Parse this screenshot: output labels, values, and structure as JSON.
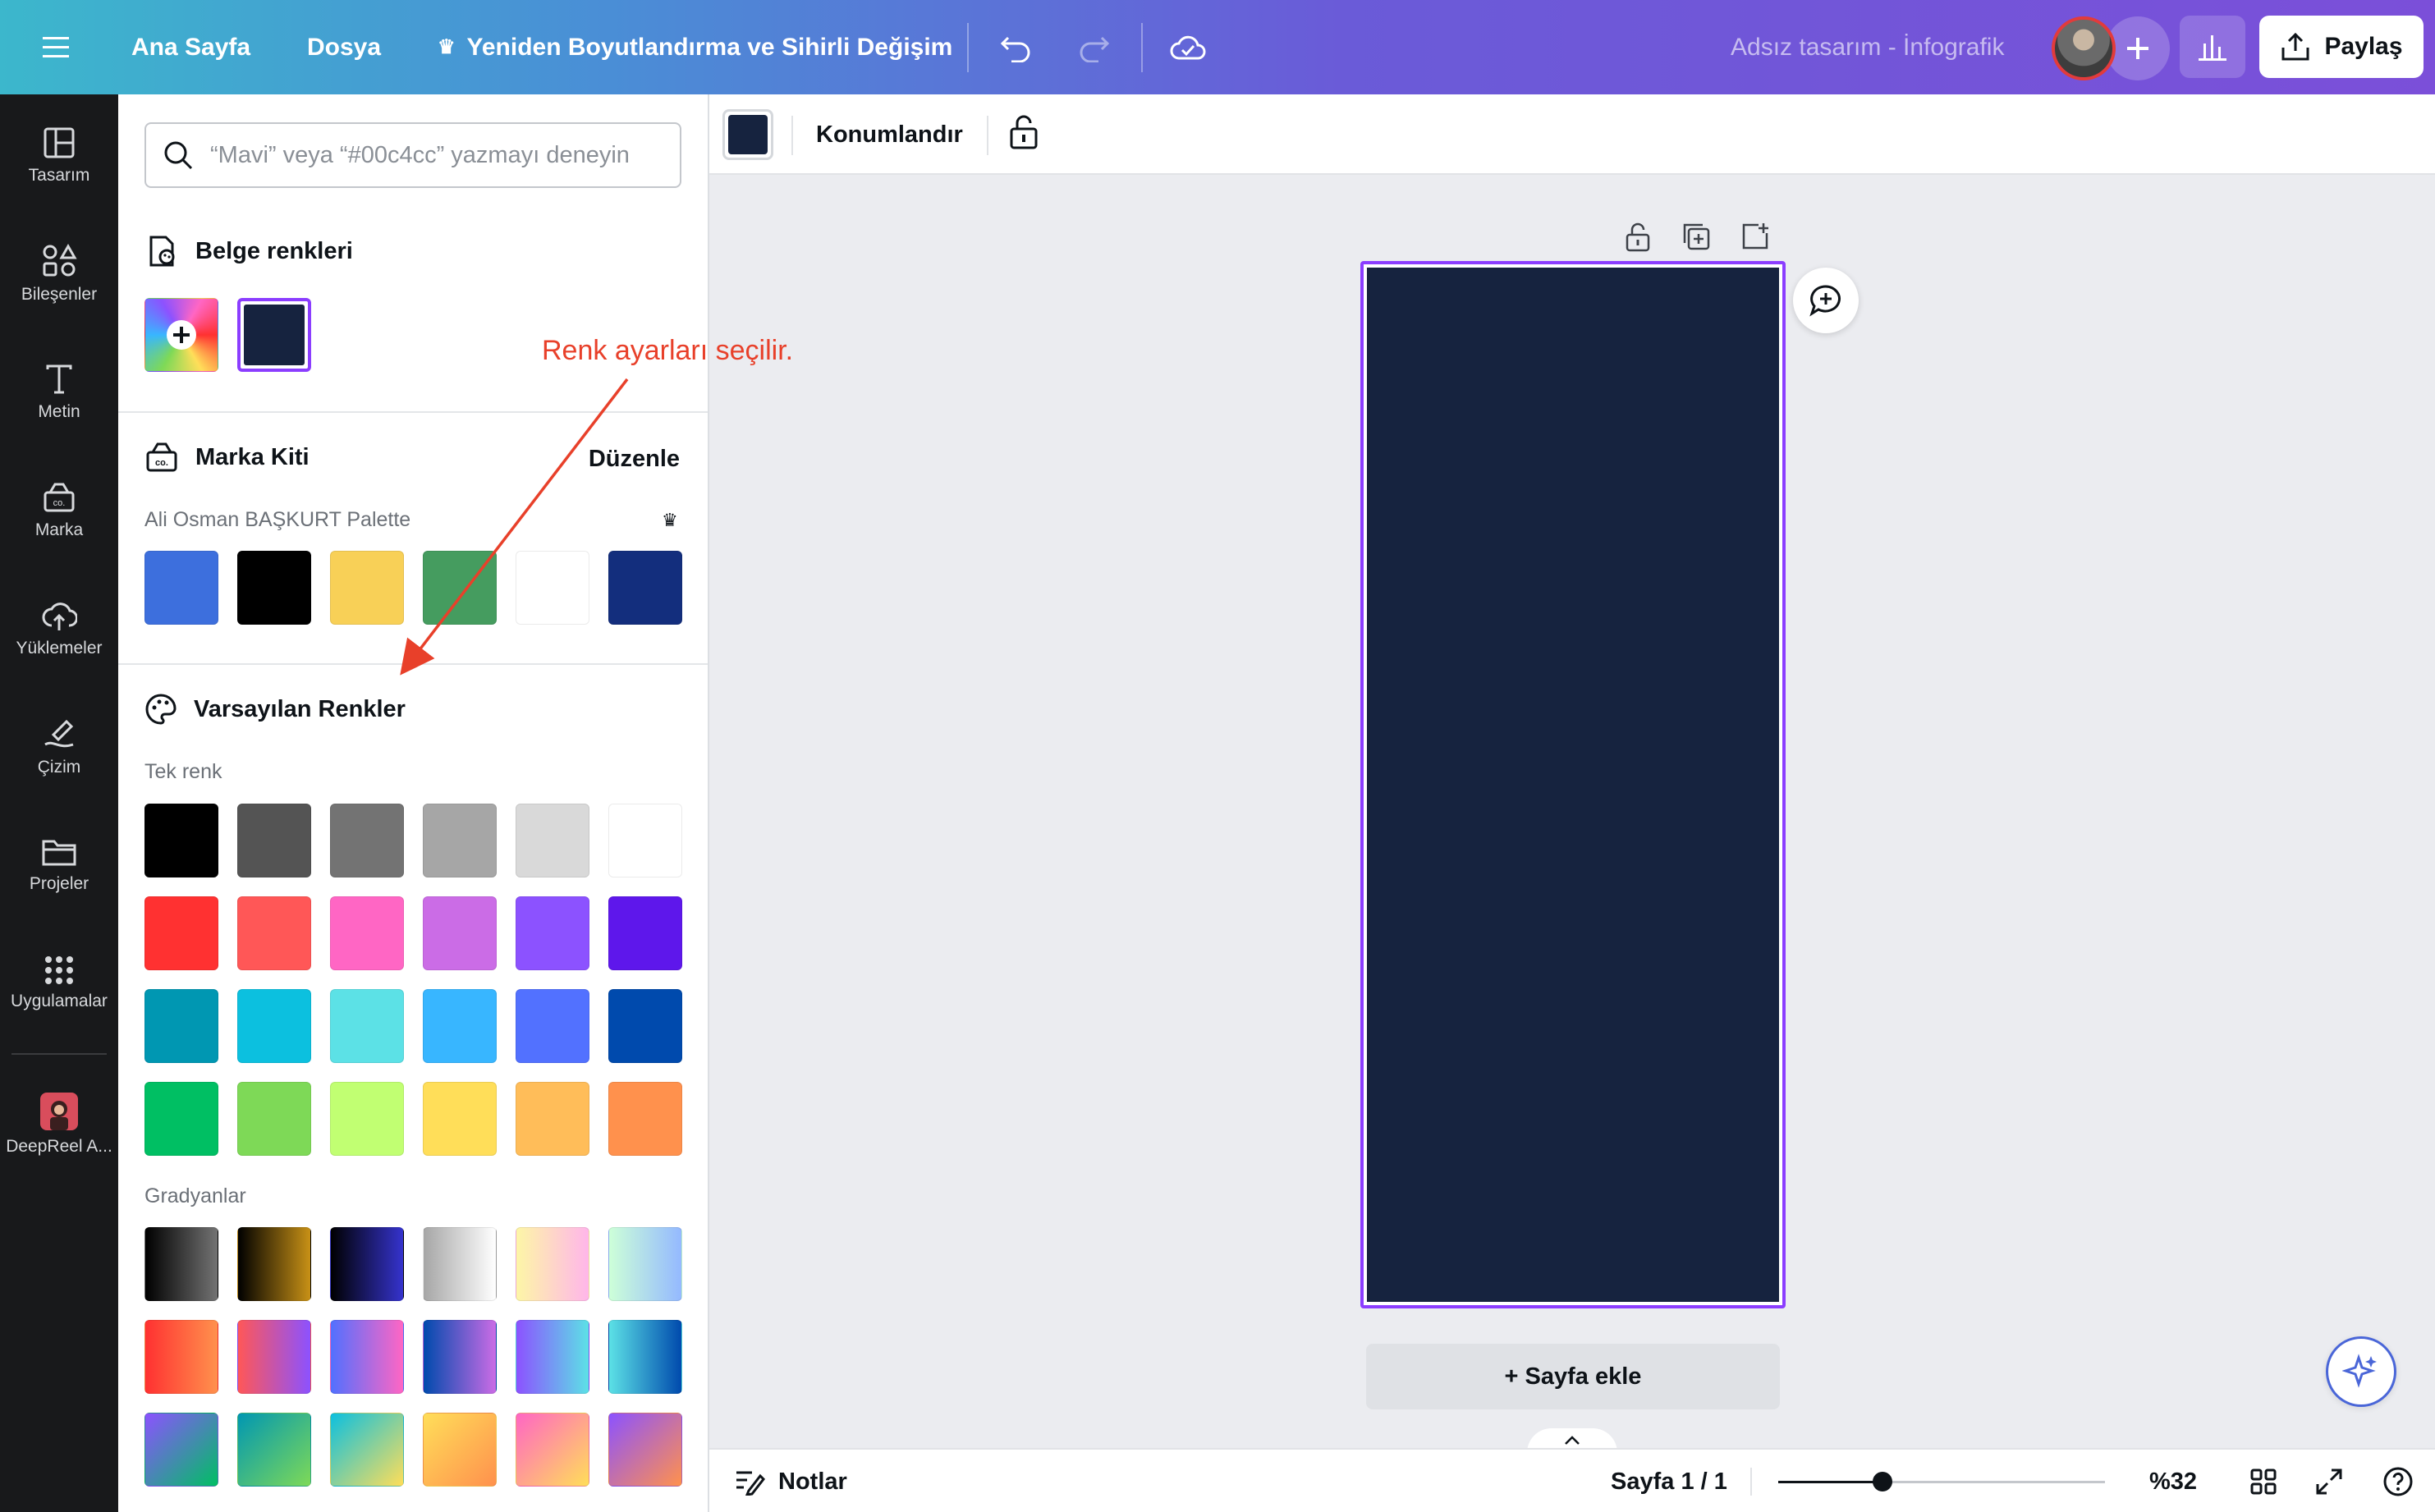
{
  "topbar": {
    "menu_icon": "hamburger-icon",
    "home": "Ana Sayfa",
    "file": "Dosya",
    "resize": "Yeniden Boyutlandırma ve Sihirli Değişim",
    "design_title": "Adsız tasarım - İnfografik",
    "share": "Paylaş"
  },
  "rail": {
    "items": [
      {
        "label": "Tasarım",
        "icon": "layout-icon"
      },
      {
        "label": "Bileşenler",
        "icon": "elements-icon"
      },
      {
        "label": "Metin",
        "icon": "text-icon"
      },
      {
        "label": "Marka",
        "icon": "brand-icon"
      },
      {
        "label": "Yüklemeler",
        "icon": "upload-icon"
      },
      {
        "label": "Çizim",
        "icon": "draw-icon"
      },
      {
        "label": "Projeler",
        "icon": "folder-icon"
      },
      {
        "label": "Uygulamalar",
        "icon": "apps-icon"
      },
      {
        "label": "DeepReel A...",
        "icon": "deepreel-app-icon"
      }
    ]
  },
  "panel": {
    "search_placeholder": "“Mavi” veya “#00c4cc” yazmayı deneyin",
    "doc_colors_title": "Belge renkleri",
    "doc_colors": [
      "#16233f"
    ],
    "brand_kit_title": "Marka Kiti",
    "brand_kit_edit": "Düzenle",
    "palette_name": "Ali Osman BAŞKURT Palette",
    "brand_colors": [
      "#3d6fdd",
      "#000000",
      "#f8d057",
      "#459c5f",
      "#ffffff",
      "#132e7d"
    ],
    "default_title": "Varsayılan Renkler",
    "solid_label": "Tek renk",
    "solid_colors": [
      [
        "#000000",
        "#545454",
        "#737373",
        "#a6a6a6",
        "#d9d9d9",
        "#ffffff"
      ],
      [
        "#ff3131",
        "#ff5757",
        "#ff66c4",
        "#cb6ce6",
        "#8c52ff",
        "#5e17eb"
      ],
      [
        "#0097b2",
        "#0cc0df",
        "#5ce1e6",
        "#38b6ff",
        "#5271ff",
        "#004aad"
      ],
      [
        "#00bf63",
        "#7ed957",
        "#c1ff72",
        "#ffde59",
        "#ffbd59",
        "#ff914d"
      ]
    ],
    "gradient_label": "Gradyanlar",
    "gradients": [
      [
        "linear-gradient(90deg,#000000,#737373)",
        "linear-gradient(90deg,#000000,#c89116)",
        "linear-gradient(90deg,#000000,#3533cd)",
        "linear-gradient(90deg,#a6a6a6,#ffffff)",
        "linear-gradient(90deg,#fdf6a6,#ffb6ea)",
        "linear-gradient(90deg,#cdffd8,#94b9ff)"
      ],
      [
        "linear-gradient(90deg,#ff3131,#ff914d)",
        "linear-gradient(90deg,#ff5757,#8c52ff)",
        "linear-gradient(90deg,#5170ff,#ff66c4)",
        "linear-gradient(90deg,#004aad,#cb6ce6)",
        "linear-gradient(90deg,#8c52ff,#5ce1e6)",
        "linear-gradient(90deg,#5ce1e6,#004aad)"
      ],
      [
        "linear-gradient(135deg,#8c52ff,#00bf63)",
        "linear-gradient(135deg,#0097b2,#7ed957)",
        "linear-gradient(135deg,#0cc0df,#ffde59)",
        "linear-gradient(135deg,#ffde59,#ff914d)",
        "linear-gradient(135deg,#ff66c4,#ffde59)",
        "linear-gradient(135deg,#8c52ff,#ff914d)"
      ]
    ]
  },
  "context_toolbar": {
    "selected_color": "#16233f",
    "position_label": "Konumlandır"
  },
  "canvas": {
    "page_color": "#16233f",
    "add_page": "+ Sayfa ekle"
  },
  "bottombar": {
    "notes": "Notlar",
    "page_indicator": "Sayfa 1 / 1",
    "zoom_fraction": 0.32,
    "zoom": "%32"
  },
  "annotation": {
    "text": "Renk ayarları seçilir.",
    "color": "#e8402a"
  }
}
